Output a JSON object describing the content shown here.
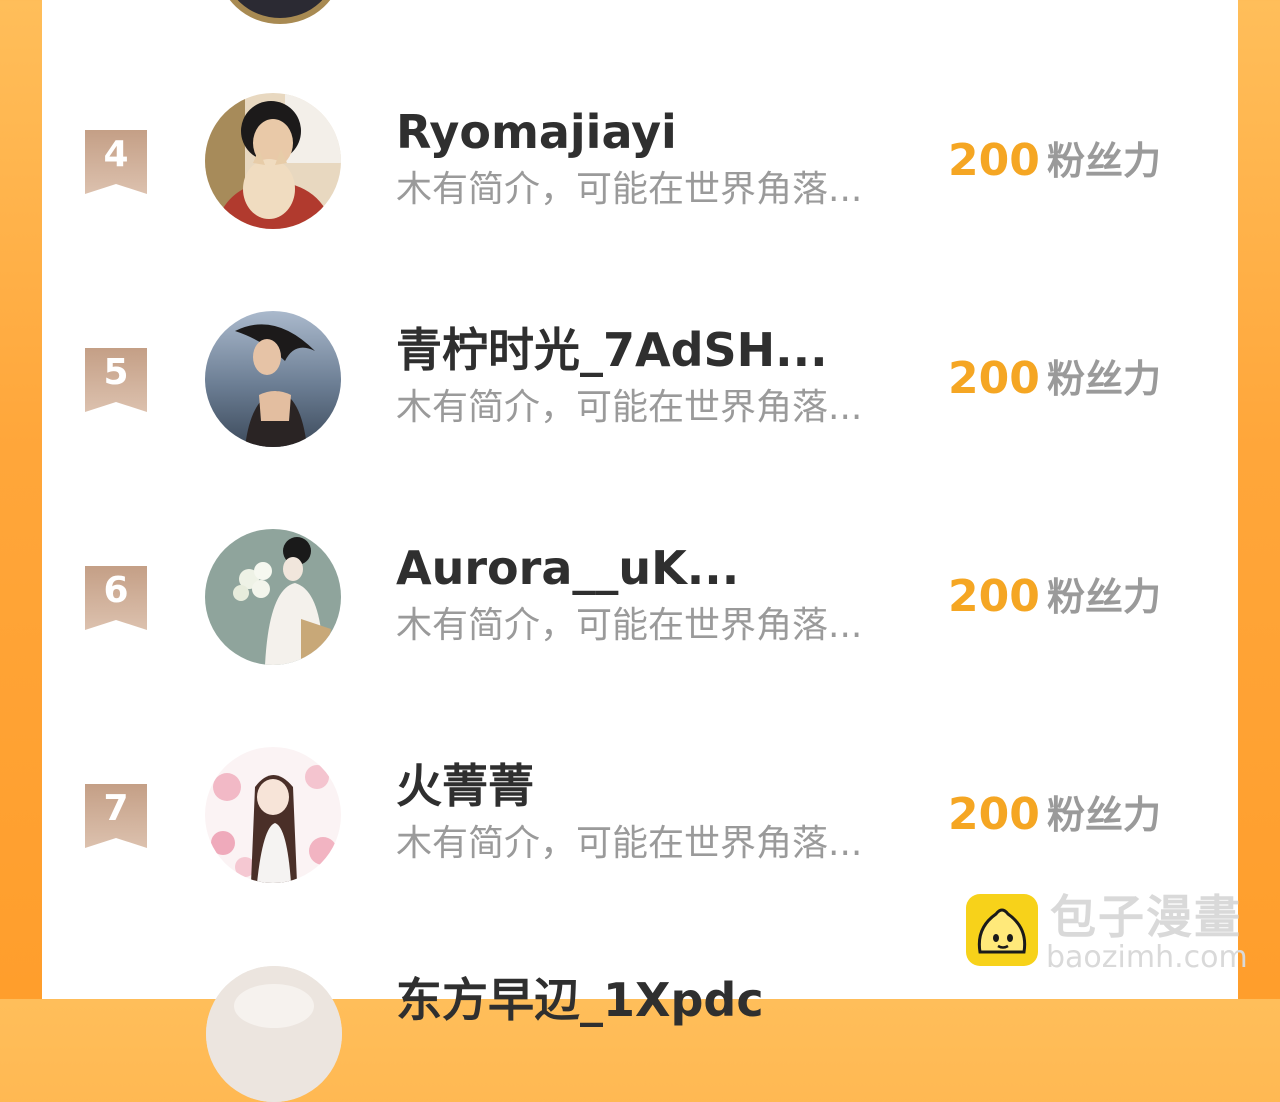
{
  "ranking": {
    "entries": [
      {
        "rank": "4",
        "name": "Ryomajiayi",
        "bio": "木有简介，可能在世界角落...",
        "score": "200",
        "unit": "粉丝力",
        "avatar": "girl-with-cat"
      },
      {
        "rank": "5",
        "name": "青柠时光_7AdSH...",
        "bio": "木有简介，可能在世界角落...",
        "score": "200",
        "unit": "粉丝力",
        "avatar": "woman-at-sea"
      },
      {
        "rank": "6",
        "name": "Aurora__uK...",
        "bio": "木有简介，可能在世界角落...",
        "score": "200",
        "unit": "粉丝力",
        "avatar": "illustrated-girl-flowers"
      },
      {
        "rank": "7",
        "name": "火菁菁",
        "bio": "木有简介，可能在世界角落...",
        "score": "200",
        "unit": "粉丝力",
        "avatar": "anime-girl-blossoms"
      }
    ],
    "partial_next_name": "东方早辺_1Xpdc"
  },
  "watermark": {
    "cn": "包子漫畫",
    "en": "baozimh.com",
    "logo_icon": "bun-mascot-icon"
  },
  "colors": {
    "score": "#f5a623",
    "badge": "#c9a58f",
    "background": "#ffa63a"
  }
}
